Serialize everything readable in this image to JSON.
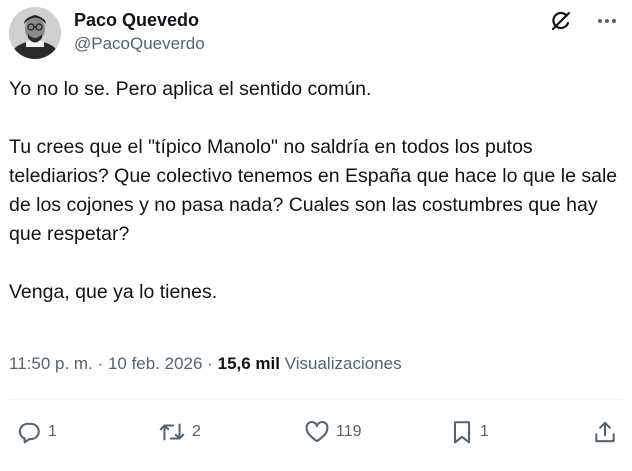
{
  "author": {
    "display_name": "Paco Quevedo",
    "handle": "@PacoQueverdo"
  },
  "header_icons": [
    "grok-icon",
    "more-icon"
  ],
  "tweet": {
    "paragraphs": [
      "Yo no lo se. Pero aplica el sentido común.",
      "Tu crees que el \"típico Manolo\" no saldría en todos los putos telediarios? Que colectivo tenemos en España que hace lo que le sale de los cojones y no pasa nada? Cuales son las costumbres que hay que respetar?",
      "Venga, que ya lo tienes."
    ]
  },
  "meta": {
    "time": "11:50 p. m.",
    "separator": "·",
    "date": "10 feb. 2026",
    "views_count": "15,6 mil",
    "views_label": "Visualizaciones"
  },
  "actions": {
    "replies": "1",
    "reposts": "2",
    "likes": "119",
    "bookmarks": "1"
  },
  "colors": {
    "text": "#0f1419",
    "secondary": "#536471",
    "divider": "#eff3f4"
  }
}
